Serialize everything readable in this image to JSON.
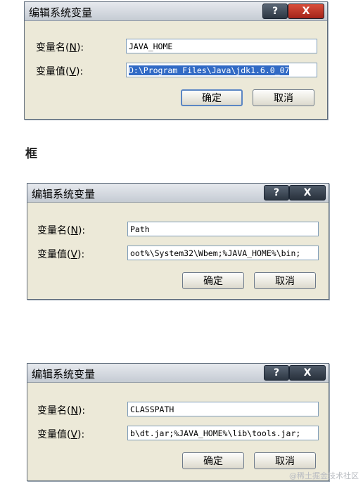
{
  "dialogs": [
    {
      "title": "编辑系统变量",
      "name_label": "变量名",
      "name_key": "N",
      "value_label": "变量值",
      "value_key": "V",
      "name_value": "JAVA_HOME",
      "value_value": "D:\\Program Files\\Java\\jdk1.6.0_07",
      "ok_label": "确定",
      "cancel_label": "取消",
      "help_label": "?",
      "close_label": "X"
    },
    {
      "title": "编辑系统变量",
      "name_label": "变量名",
      "name_key": "N",
      "value_label": "变量值",
      "value_key": "V",
      "name_value": "Path",
      "value_value": "oot%\\System32\\Wbem;%JAVA_HOME%\\bin;",
      "ok_label": "确定",
      "cancel_label": "取消",
      "help_label": "?",
      "close_label": "X"
    },
    {
      "title": "编辑系统变量",
      "name_label": "变量名",
      "name_key": "N",
      "value_label": "变量值",
      "value_key": "V",
      "name_value": "CLASSPATH",
      "value_value": "b\\dt.jar;%JAVA_HOME%\\lib\\tools.jar;",
      "ok_label": "确定",
      "cancel_label": "取消",
      "help_label": "?",
      "close_label": "X"
    }
  ],
  "stray_text": "框",
  "watermark": "@稀土掘金技术社区"
}
